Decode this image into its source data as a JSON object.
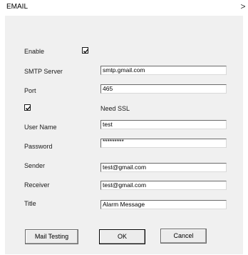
{
  "window": {
    "title": "EMAIL",
    "close_glyph": ">"
  },
  "form": {
    "enable": {
      "label": "Enable",
      "checked": true
    },
    "smtp_server": {
      "label": "SMTP Server",
      "value": "smtp.gmail.com"
    },
    "port": {
      "label": "Port",
      "value": "465"
    },
    "need_ssl": {
      "label": "Need SSL",
      "checked": true
    },
    "user_name": {
      "label": "User Name",
      "value": "test"
    },
    "password": {
      "label": "Password",
      "value": "*********"
    },
    "sender": {
      "label": "Sender",
      "value": "test@gmail.com"
    },
    "receiver": {
      "label": "Receiver",
      "value": "test@gmail.com"
    },
    "title": {
      "label": "Title",
      "value": "Alarm Message"
    }
  },
  "buttons": {
    "mail_testing": "Mail Testing",
    "ok": "OK",
    "cancel": "Cancel"
  }
}
